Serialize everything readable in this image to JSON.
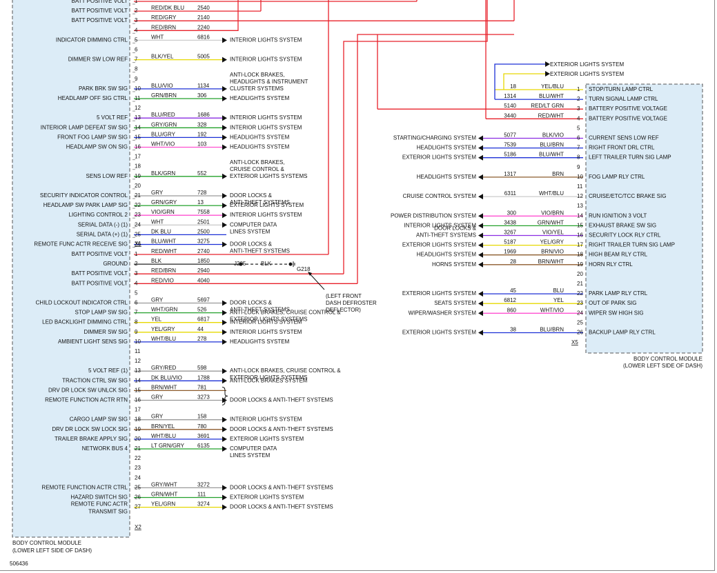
{
  "diagram_id": "506436",
  "colors": {
    "module_fill": "#dcecf7",
    "module_border": "#555555",
    "grid_wire": "#222222",
    "wire_red": "#e8202a",
    "wire_blue": "#1b2fd6",
    "wire_violet": "#8a2be2",
    "wire_green": "#22a02a",
    "wire_yellow": "#e6d800",
    "wire_gray": "#999999",
    "wire_brown": "#8b5a2b",
    "wire_pink": "#ff4fd0",
    "wire_white": "#cccccc"
  },
  "modules": {
    "left": {
      "title_line1": "BODY CONTROL MODULE",
      "title_line2": "(LOWER LEFT SIDE OF DASH)"
    },
    "right": {
      "title_line1": "BODY CONTROL MODULE",
      "title_line2": "(LOWER LEFT SIDE OF DASH)"
    }
  },
  "connectors": {
    "x1": "X1",
    "x2": "X2",
    "x5": "X5"
  },
  "ground": {
    "splice": "J205",
    "splice_color": "BLK",
    "ground_id": "G218",
    "note_line1": "(LEFT FRONT",
    "note_line2": "DASH DEFROSTER",
    "note_line3": "DEFLECTOR)"
  },
  "x1_pins": [
    {
      "pin": "1",
      "label": "BATT POSITIVE VOLT",
      "color": "",
      "circuit": "",
      "dest": [],
      "wire": "red"
    },
    {
      "pin": "2",
      "label": "BATT POSITIVE VOLT",
      "color": "RED/DK BLU",
      "circuit": "2540",
      "dest": [],
      "wire": "red"
    },
    {
      "pin": "3",
      "label": "BATT POSITIVE VOLT",
      "color": "RED/GRY",
      "circuit": "2140",
      "dest": [],
      "wire": "red"
    },
    {
      "pin": "4",
      "label": "",
      "color": "RED/BRN",
      "circuit": "2240",
      "dest": [],
      "wire": "red"
    },
    {
      "pin": "5",
      "label": "INDICATOR DIMMING CTRL",
      "color": "WHT",
      "circuit": "6816",
      "dest": [
        "INTERIOR LIGHTS SYSTEM"
      ],
      "wire": "white"
    },
    {
      "pin": "6",
      "label": "",
      "color": "",
      "circuit": "",
      "dest": [],
      "wire": ""
    },
    {
      "pin": "7",
      "label": "DIMMER SW LOW REF",
      "color": "BLK/YEL",
      "circuit": "5005",
      "dest": [
        "INTERIOR LIGHTS SYSTEM"
      ],
      "wire": "yellow"
    },
    {
      "pin": "8",
      "label": "",
      "color": "",
      "circuit": "",
      "dest": [],
      "wire": ""
    },
    {
      "pin": "9",
      "label": "",
      "color": "",
      "circuit": "",
      "dest": [],
      "wire": ""
    },
    {
      "pin": "10",
      "label": "PARK BRK SW SIG",
      "color": "BLU/VIO",
      "circuit": "1134",
      "dest": [
        "ANTI-LOCK BRAKES,",
        "HEADLIGHTS & INSTRUMENT",
        "CLUSTER SYSTEMS"
      ],
      "wire": "blue"
    },
    {
      "pin": "11",
      "label": "HEADLAMP OFF SIG CTRL",
      "color": "GRN/BRN",
      "circuit": "306",
      "dest": [
        "HEADLIGHTS SYSTEM"
      ],
      "wire": "green"
    },
    {
      "pin": "12",
      "label": "",
      "color": "",
      "circuit": "",
      "dest": [],
      "wire": ""
    },
    {
      "pin": "13",
      "label": "5 VOLT REF",
      "color": "BLU/RED",
      "circuit": "1686",
      "dest": [
        "INTERIOR LIGHTS SYSTEM"
      ],
      "wire": "violet"
    },
    {
      "pin": "14",
      "label": "INTERIOR LAMP DEFEAT SW SIG",
      "color": "GRY/GRN",
      "circuit": "328",
      "dest": [
        "INTERIOR LIGHTS SYSTEM"
      ],
      "wire": "green"
    },
    {
      "pin": "15",
      "label": "FRONT FOG LAMP SW SIG",
      "color": "BLU/GRY",
      "circuit": "192",
      "dest": [
        "HEADLIGHTS SYSTEM"
      ],
      "wire": "blue"
    },
    {
      "pin": "16",
      "label": "HEADLAMP SW ON SIG",
      "color": "WHT/VIO",
      "circuit": "103",
      "dest": [
        "HEADLIGHTS SYSTEM"
      ],
      "wire": "pink"
    },
    {
      "pin": "17",
      "label": "",
      "color": "",
      "circuit": "",
      "dest": [],
      "wire": ""
    },
    {
      "pin": "18",
      "label": "",
      "color": "",
      "circuit": "",
      "dest": [],
      "wire": ""
    },
    {
      "pin": "19",
      "label": "SENS LOW REF",
      "color": "BLK/GRN",
      "circuit": "552",
      "dest": [
        "ANTI-LOCK BRAKES,",
        "CRUISE CONTROL &",
        "EXTERIOR LIGHTS SYSTEMS"
      ],
      "wire": "green"
    },
    {
      "pin": "20",
      "label": "",
      "color": "",
      "circuit": "",
      "dest": [],
      "wire": ""
    },
    {
      "pin": "21",
      "label": "SECURITY INDICATOR CONTROL",
      "color": "GRY",
      "circuit": "728",
      "dest": [
        "DOOR LOCKS &",
        "ANTI-THEFT SYSTEMS"
      ],
      "wire": "gray"
    },
    {
      "pin": "22",
      "label": "HEADLAMP SW PARK LAMP SIG",
      "color": "GRN/GRY",
      "circuit": "13",
      "dest": [
        "EXTERIOR LIGHTS SYSTEM"
      ],
      "wire": "green"
    },
    {
      "pin": "23",
      "label": "LIGHTING CONTROL 2",
      "color": "VIO/GRN",
      "circuit": "7558",
      "dest": [
        "INTERIOR LIGHTS SYSTEM"
      ],
      "wire": "pink"
    },
    {
      "pin": "24",
      "label": "SERIAL DATA (-) (1)",
      "color": "WHT",
      "circuit": "2501",
      "dest": [
        "COMPUTER DATA",
        "LINES SYSTEM"
      ],
      "wire": "white"
    },
    {
      "pin": "25",
      "label": "SERIAL DATA (+) (1)",
      "color": "DK BLU",
      "circuit": "2500",
      "dest": [],
      "wire": "blue"
    },
    {
      "pin": "26",
      "label": "REMOTE FUNC ACTR RECEIVE SIG",
      "color": "BLU/WHT",
      "circuit": "3275",
      "dest": [
        "DOOR LOCKS &",
        "ANTI-THEFT SYSTEMS"
      ],
      "wire": "blue"
    }
  ],
  "x2_pins": [
    {
      "pin": "1",
      "label": "BATT POSITIVE VOLT",
      "color": "RED/WHT",
      "circuit": "2740",
      "dest": [],
      "wire": "red"
    },
    {
      "pin": "2",
      "label": "GROUND",
      "color": "BLK",
      "circuit": "1850",
      "dest": [],
      "wire": "black"
    },
    {
      "pin": "3",
      "label": "BATT POSITIVE VOLT",
      "color": "RED/BRN",
      "circuit": "2940",
      "dest": [],
      "wire": "red"
    },
    {
      "pin": "4",
      "label": "BATT POSITIVE VOLT",
      "color": "RED/VIO",
      "circuit": "4040",
      "dest": [],
      "wire": "red"
    },
    {
      "pin": "5",
      "label": "",
      "color": "",
      "circuit": "",
      "dest": [],
      "wire": ""
    },
    {
      "pin": "6",
      "label": "CHILD LOCKOUT INDICATOR CTRL",
      "color": "GRY",
      "circuit": "5697",
      "dest": [
        "DOOR LOCKS &",
        "ANTI-THEFT SYSTEMS"
      ],
      "wire": "gray"
    },
    {
      "pin": "7",
      "label": "STOP LAMP SW SIG",
      "color": "WHT/GRN",
      "circuit": "526",
      "dest": [
        "ANTI-LOCK BRAKES, CRUISE CONTROL &",
        "EXTERIOR LIGHTS SYSTEMS"
      ],
      "wire": "green"
    },
    {
      "pin": "8",
      "label": "LED BACKLIGHT DIMMING CTRL",
      "color": "YEL",
      "circuit": "6817",
      "dest": [
        "INTERIOR LIGHTS SYSTEM"
      ],
      "wire": "yellow"
    },
    {
      "pin": "9",
      "label": "DIMMER SW SIG",
      "color": "YEL/GRY",
      "circuit": "44",
      "dest": [
        "INTERIOR LIGHTS SYSTEM"
      ],
      "wire": "yellow"
    },
    {
      "pin": "10",
      "label": "AMBIENT LIGHT SENS SIG",
      "color": "WHT/BLU",
      "circuit": "278",
      "dest": [
        "HEADLIGHTS SYSTEM"
      ],
      "wire": "blue"
    },
    {
      "pin": "11",
      "label": "",
      "color": "",
      "circuit": "",
      "dest": [],
      "wire": ""
    },
    {
      "pin": "12",
      "label": "",
      "color": "",
      "circuit": "",
      "dest": [],
      "wire": ""
    },
    {
      "pin": "13",
      "label": "5 VOLT REF (1)",
      "color": "GRY/RED",
      "circuit": "598",
      "dest": [
        "ANTI-LOCK BRAKES, CRUISE CONTROL &",
        "EXTERIOR LIGHTS SYSTEMS"
      ],
      "wire": "gray"
    },
    {
      "pin": "14",
      "label": "TRACTION CTRL SW SIG",
      "color": "DK BLU/VIO",
      "circuit": "1788",
      "dest": [
        "ANTI-LOCK BRAKES SYSTEM"
      ],
      "wire": "blue"
    },
    {
      "pin": "15",
      "label": "DRV DR LOCK SW UNLCK SIG",
      "color": "BRN/WHT",
      "circuit": "781",
      "dest": [],
      "wire": "brown"
    },
    {
      "pin": "16",
      "label": "REMOTE FUNCTION ACTR RTN",
      "color": "GRY",
      "circuit": "3273",
      "dest": [
        "DOOR LOCKS & ANTI-THEFT SYSTEMS"
      ],
      "wire": "gray"
    },
    {
      "pin": "17",
      "label": "",
      "color": "",
      "circuit": "",
      "dest": [],
      "wire": ""
    },
    {
      "pin": "18",
      "label": "CARGO LAMP SW SIG",
      "color": "GRY",
      "circuit": "158",
      "dest": [
        "INTERIOR LIGHTS SYSTEM"
      ],
      "wire": "gray"
    },
    {
      "pin": "19",
      "label": "DRV DR LOCK SW LOCK SIG",
      "color": "BRN/YEL",
      "circuit": "780",
      "dest": [
        "DOOR LOCKS & ANTI-THEFT SYSTEMS"
      ],
      "wire": "brown"
    },
    {
      "pin": "20",
      "label": "TRAILER BRAKE APPLY SIG",
      "color": "WHT/BLU",
      "circuit": "3691",
      "dest": [
        "EXTERIOR LIGHTS SYSTEM"
      ],
      "wire": "blue"
    },
    {
      "pin": "21",
      "label": "NETWORK BUS 4",
      "color": "LT GRN/GRY",
      "circuit": "6135",
      "dest": [
        "COMPUTER DATA",
        "LINES SYSTEM"
      ],
      "wire": "green"
    },
    {
      "pin": "22",
      "label": "",
      "color": "",
      "circuit": "",
      "dest": [],
      "wire": ""
    },
    {
      "pin": "23",
      "label": "",
      "color": "",
      "circuit": "",
      "dest": [],
      "wire": ""
    },
    {
      "pin": "24",
      "label": "",
      "color": "",
      "circuit": "",
      "dest": [],
      "wire": ""
    },
    {
      "pin": "25",
      "label": "REMOTE FUNCTION ACTR CTRL",
      "color": "GRY/WHT",
      "circuit": "3272",
      "dest": [
        "DOOR LOCKS & ANTI-THEFT SYSTEMS"
      ],
      "wire": "gray"
    },
    {
      "pin": "26",
      "label": "HAZARD SWITCH SIG",
      "color": "GRN/WHT",
      "circuit": "111",
      "dest": [
        "EXTERIOR LIGHTS SYSTEM"
      ],
      "wire": "green"
    },
    {
      "pin": "27",
      "label": "REMOTE FUNC ACTR TRANSMIT SIG",
      "color": "YEL/GRN",
      "circuit": "3274",
      "dest": [
        "DOOR LOCKS & ANTI-THEFT SYSTEMS"
      ],
      "wire": "yellow"
    }
  ],
  "x5_pins": [
    {
      "pin": "1",
      "label": "STOP/TURN LAMP CTRL",
      "color": "YEL/BLU",
      "circuit": "18",
      "dest": "",
      "wire": "yellow"
    },
    {
      "pin": "2",
      "label": "TURN SIGNAL LAMP CTRL",
      "color": "BLU/WHT",
      "circuit": "1314",
      "dest": "",
      "wire": "blue"
    },
    {
      "pin": "3",
      "label": "BATTERY POSITIVE VOLTAGE",
      "color": "RED/LT GRN",
      "circuit": "5140",
      "dest": "",
      "wire": "red"
    },
    {
      "pin": "4",
      "label": "BATTERY POSITIVE VOLTAGE",
      "color": "RED/WHT",
      "circuit": "3440",
      "dest": "",
      "wire": "red"
    },
    {
      "pin": "5",
      "label": "",
      "color": "",
      "circuit": "",
      "dest": "",
      "wire": ""
    },
    {
      "pin": "6",
      "label": "CURRENT SENS LOW REF",
      "color": "BLK/VIO",
      "circuit": "5077",
      "dest": "STARTING/CHARGING SYSTEM",
      "wire": "violet"
    },
    {
      "pin": "7",
      "label": "RIGHT FRONT DRL CTRL",
      "color": "BLU/BRN",
      "circuit": "7539",
      "dest": "HEADLIGHTS SYSTEM",
      "wire": "blue"
    },
    {
      "pin": "8",
      "label": "LEFT TRAILER TURN SIG LAMP",
      "color": "BLU/WHT",
      "circuit": "5186",
      "dest": "EXTERIOR LIGHTS SYSTEM",
      "wire": "blue"
    },
    {
      "pin": "9",
      "label": "",
      "color": "",
      "circuit": "",
      "dest": "",
      "wire": ""
    },
    {
      "pin": "10",
      "label": "FOG LAMP RLY CTRL",
      "color": "BRN",
      "circuit": "1317",
      "dest": "HEADLIGHTS SYSTEM",
      "wire": "brown"
    },
    {
      "pin": "11",
      "label": "",
      "color": "",
      "circuit": "",
      "dest": "",
      "wire": ""
    },
    {
      "pin": "12",
      "label": "CRUISE/ETC/TCC BRAKE SIG",
      "color": "WHT/BLU",
      "circuit": "6311",
      "dest": "CRUISE CONTROL SYSTEM",
      "wire": "white"
    },
    {
      "pin": "13",
      "label": "",
      "color": "",
      "circuit": "",
      "dest": "",
      "wire": ""
    },
    {
      "pin": "14",
      "label": "RUN IGNITION 3 VOLT",
      "color": "VIO/BRN",
      "circuit": "300",
      "dest": "POWER DISTRIBUTION SYSTEM",
      "wire": "pink"
    },
    {
      "pin": "15",
      "label": "EXHAUST BRAKE SW SIG",
      "color": "GRN/WHT",
      "circuit": "3438",
      "dest": "INTERIOR LIGHTS SYSTEM",
      "wire": "green"
    },
    {
      "pin": "16",
      "label": "SECURITY LOCK RLY CTRL",
      "color": "VIO/YEL",
      "circuit": "3267",
      "dest": "DOOR LOCKS &|ANTI-THEFT SYSTEMS",
      "wire": "violet"
    },
    {
      "pin": "17",
      "label": "RIGHT TRAILER TURN SIG LAMP",
      "color": "YEL/GRY",
      "circuit": "5187",
      "dest": "EXTERIOR LIGHTS SYSTEM",
      "wire": "yellow"
    },
    {
      "pin": "18",
      "label": "HIGH BEAM RLY CTRL",
      "color": "BRN/VIO",
      "circuit": "1969",
      "dest": "HEADLIGHTS SYSTEM",
      "wire": "brown"
    },
    {
      "pin": "19",
      "label": "HORN RLY CTRL",
      "color": "BRN/WHT",
      "circuit": "28",
      "dest": "HORNS SYSTEM",
      "wire": "brown"
    },
    {
      "pin": "20",
      "label": "",
      "color": "",
      "circuit": "",
      "dest": "",
      "wire": ""
    },
    {
      "pin": "21",
      "label": "",
      "color": "",
      "circuit": "",
      "dest": "",
      "wire": ""
    },
    {
      "pin": "22",
      "label": "PARK LAMP RLY CTRL",
      "color": "BLU",
      "circuit": "45",
      "dest": "EXTERIOR LIGHTS SYSTEM",
      "wire": "blue"
    },
    {
      "pin": "23",
      "label": "OUT OF PARK SIG",
      "color": "YEL",
      "circuit": "6812",
      "dest": "SEATS SYSTEM",
      "wire": "yellow"
    },
    {
      "pin": "24",
      "label": "WIPER SW HIGH SIG",
      "color": "WHT/VIO",
      "circuit": "860",
      "dest": "WIPER/WASHER SYSTEM",
      "wire": "pink"
    },
    {
      "pin": "25",
      "label": "",
      "color": "",
      "circuit": "",
      "dest": "",
      "wire": ""
    },
    {
      "pin": "26",
      "label": "BACKUP LAMP RLY CTRL",
      "color": "BLU/BRN",
      "circuit": "38",
      "dest": "EXTERIOR LIGHTS SYSTEM",
      "wire": "blue"
    }
  ],
  "x5_top_dest": [
    "EXTERIOR LIGHTS SYSTEM",
    "EXTERIOR LIGHTS SYSTEM"
  ]
}
